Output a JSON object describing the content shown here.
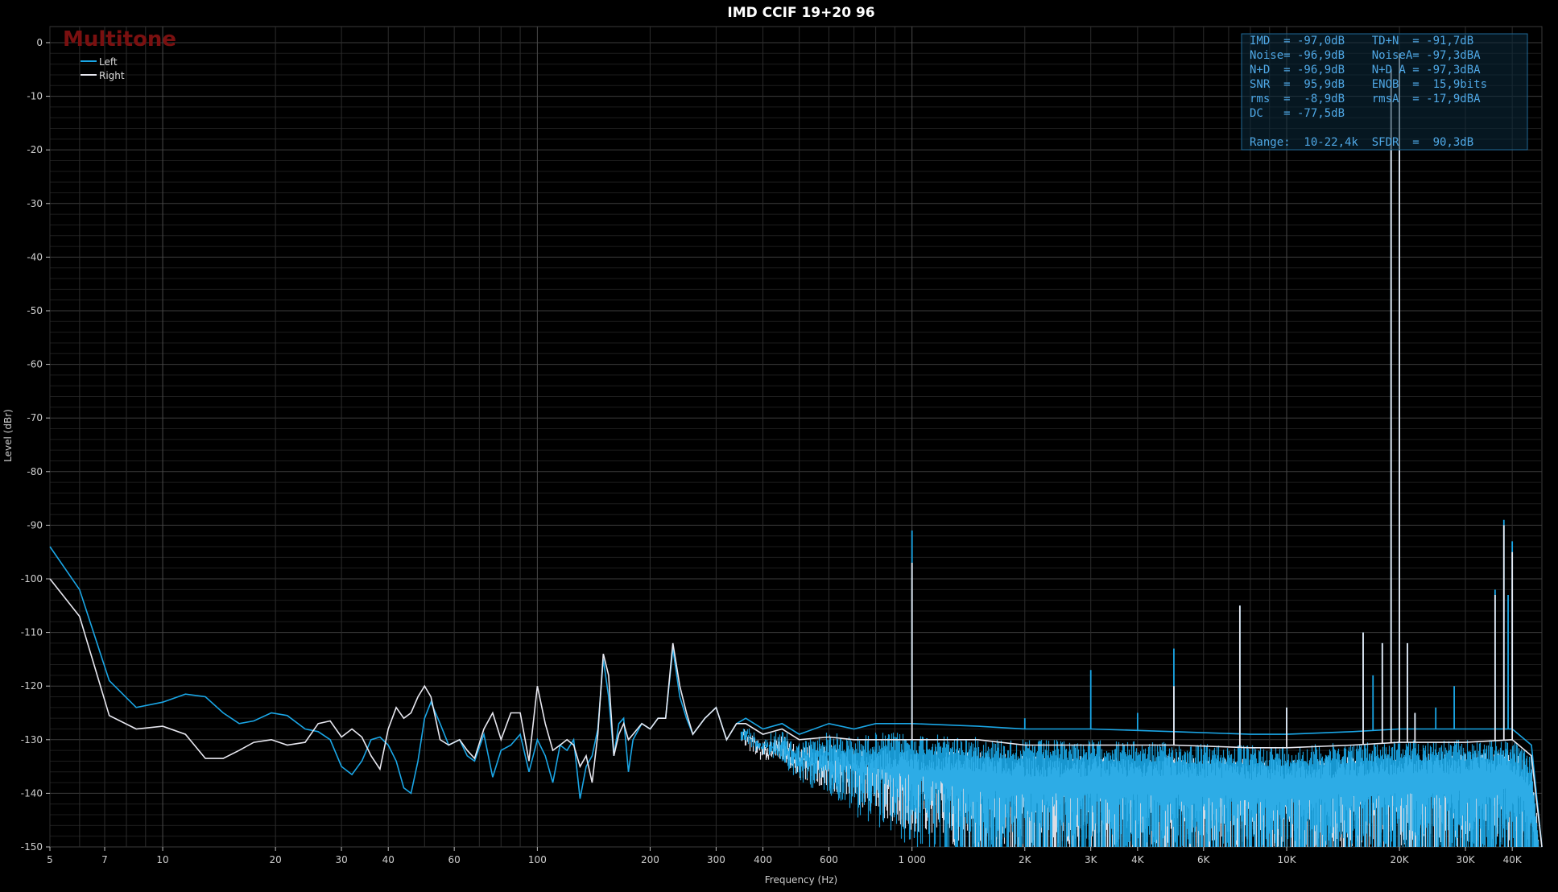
{
  "chart_data": {
    "type": "line",
    "title": "IMD CCIF 19+20 96",
    "brand": "Multitone",
    "xlabel": "Frequency (Hz)",
    "ylabel": "Level (dBr)",
    "x_scale": "log",
    "xlim": [
      5,
      48000
    ],
    "ylim": [
      -150,
      3
    ],
    "grid": true,
    "legend_position": "top-left",
    "x_ticks": [
      {
        "v": 5,
        "label": "5"
      },
      {
        "v": 7,
        "label": "7"
      },
      {
        "v": 10,
        "label": "10"
      },
      {
        "v": 20,
        "label": "20"
      },
      {
        "v": 30,
        "label": "30"
      },
      {
        "v": 40,
        "label": "40"
      },
      {
        "v": 60,
        "label": "60"
      },
      {
        "v": 100,
        "label": "100"
      },
      {
        "v": 200,
        "label": "200"
      },
      {
        "v": 300,
        "label": "300"
      },
      {
        "v": 400,
        "label": "400"
      },
      {
        "v": 600,
        "label": "600"
      },
      {
        "v": 1000,
        "label": "1 000"
      },
      {
        "v": 2000,
        "label": "2K"
      },
      {
        "v": 3000,
        "label": "3K"
      },
      {
        "v": 4000,
        "label": "4K"
      },
      {
        "v": 6000,
        "label": "6K"
      },
      {
        "v": 10000,
        "label": "10K"
      },
      {
        "v": 20000,
        "label": "20K"
      },
      {
        "v": 30000,
        "label": "30K"
      },
      {
        "v": 40000,
        "label": "40K"
      }
    ],
    "y_ticks": [
      0,
      -10,
      -20,
      -30,
      -40,
      -50,
      -60,
      -70,
      -80,
      -90,
      -100,
      -110,
      -120,
      -130,
      -140,
      -150
    ],
    "series": [
      {
        "name": "Left",
        "color": "#1aa6e6",
        "points": [
          [
            5,
            -94
          ],
          [
            6,
            -102
          ],
          [
            7.2,
            -119
          ],
          [
            8.5,
            -124
          ],
          [
            10,
            -123
          ],
          [
            11.5,
            -121.5
          ],
          [
            13,
            -122
          ],
          [
            14.5,
            -125
          ],
          [
            16,
            -127
          ],
          [
            17.5,
            -126.5
          ],
          [
            19.5,
            -125
          ],
          [
            21.5,
            -125.5
          ],
          [
            24,
            -128
          ],
          [
            26,
            -128.5
          ],
          [
            28,
            -130
          ],
          [
            30,
            -135
          ],
          [
            32,
            -136.5
          ],
          [
            34,
            -134
          ],
          [
            36,
            -130
          ],
          [
            38,
            -129.5
          ],
          [
            40,
            -131
          ],
          [
            42,
            -134
          ],
          [
            44,
            -139
          ],
          [
            46,
            -140
          ],
          [
            48,
            -134
          ],
          [
            50,
            -126
          ],
          [
            52,
            -123
          ],
          [
            55,
            -127
          ],
          [
            58,
            -131
          ],
          [
            62,
            -130
          ],
          [
            65,
            -133
          ],
          [
            68,
            -134
          ],
          [
            72,
            -129
          ],
          [
            76,
            -137
          ],
          [
            80,
            -132
          ],
          [
            85,
            -131
          ],
          [
            90,
            -129
          ],
          [
            95,
            -136
          ],
          [
            100,
            -130
          ],
          [
            105,
            -133
          ],
          [
            110,
            -138
          ],
          [
            115,
            -131
          ],
          [
            120,
            -132
          ],
          [
            125,
            -130
          ],
          [
            130,
            -141
          ],
          [
            135,
            -135
          ],
          [
            140,
            -133
          ],
          [
            145,
            -128
          ],
          [
            150,
            -115
          ],
          [
            155,
            -122
          ],
          [
            160,
            -133
          ],
          [
            165,
            -127
          ],
          [
            170,
            -126
          ],
          [
            175,
            -136
          ],
          [
            180,
            -130
          ],
          [
            190,
            -127
          ],
          [
            200,
            -128
          ],
          [
            210,
            -126
          ],
          [
            220,
            -126
          ],
          [
            230,
            -113
          ],
          [
            240,
            -122
          ],
          [
            250,
            -126
          ],
          [
            260,
            -129
          ],
          [
            280,
            -126
          ],
          [
            300,
            -124
          ],
          [
            320,
            -130
          ],
          [
            340,
            -127
          ],
          [
            360,
            -126
          ],
          [
            400,
            -128
          ],
          [
            450,
            -127
          ],
          [
            500,
            -129
          ],
          [
            600,
            -127
          ],
          [
            700,
            -128
          ],
          [
            800,
            -127
          ],
          [
            900,
            -127
          ],
          [
            1000,
            -127
          ],
          [
            1500,
            -127.5
          ],
          [
            2000,
            -128
          ],
          [
            3000,
            -128
          ],
          [
            5000,
            -128.5
          ],
          [
            8000,
            -129
          ],
          [
            10000,
            -129
          ],
          [
            15000,
            -128.5
          ],
          [
            20000,
            -128
          ],
          [
            30000,
            -128
          ],
          [
            40000,
            -128
          ],
          [
            45000,
            -131
          ],
          [
            48000,
            -150
          ]
        ],
        "noise_floor_level": -130,
        "spikes": [
          [
            1000,
            -91
          ],
          [
            2000,
            -126
          ],
          [
            3000,
            -117
          ],
          [
            4000,
            -125
          ],
          [
            5000,
            -113
          ],
          [
            7500,
            -105
          ],
          [
            10000,
            -124
          ],
          [
            16000,
            -110
          ],
          [
            17000,
            -118
          ],
          [
            18000,
            -112
          ],
          [
            19000,
            -5
          ],
          [
            20000,
            -2
          ],
          [
            21000,
            -112
          ],
          [
            22000,
            -125
          ],
          [
            25000,
            -124
          ],
          [
            28000,
            -120
          ],
          [
            36000,
            -102
          ],
          [
            38000,
            -89
          ],
          [
            39000,
            -103
          ],
          [
            40000,
            -93
          ]
        ]
      },
      {
        "name": "Right",
        "color": "#e8e8f0",
        "points": [
          [
            5,
            -100
          ],
          [
            6,
            -107
          ],
          [
            7.2,
            -125.5
          ],
          [
            8.5,
            -128
          ],
          [
            10,
            -127.5
          ],
          [
            11.5,
            -129
          ],
          [
            13,
            -133.5
          ],
          [
            14.5,
            -133.5
          ],
          [
            16,
            -132
          ],
          [
            17.5,
            -130.5
          ],
          [
            19.5,
            -130
          ],
          [
            21.5,
            -131
          ],
          [
            24,
            -130.5
          ],
          [
            26,
            -127
          ],
          [
            28,
            -126.5
          ],
          [
            30,
            -129.5
          ],
          [
            32,
            -128
          ],
          [
            34,
            -129.5
          ],
          [
            36,
            -133
          ],
          [
            38,
            -135.5
          ],
          [
            40,
            -128
          ],
          [
            42,
            -124
          ],
          [
            44,
            -126
          ],
          [
            46,
            -125
          ],
          [
            48,
            -122
          ],
          [
            50,
            -120
          ],
          [
            52,
            -122
          ],
          [
            55,
            -130
          ],
          [
            58,
            -131
          ],
          [
            62,
            -130
          ],
          [
            65,
            -132
          ],
          [
            68,
            -133.5
          ],
          [
            72,
            -128
          ],
          [
            76,
            -125
          ],
          [
            80,
            -130
          ],
          [
            85,
            -125
          ],
          [
            90,
            -125
          ],
          [
            95,
            -134
          ],
          [
            100,
            -120
          ],
          [
            105,
            -127
          ],
          [
            110,
            -132
          ],
          [
            115,
            -131
          ],
          [
            120,
            -130
          ],
          [
            125,
            -131
          ],
          [
            130,
            -135
          ],
          [
            135,
            -133
          ],
          [
            140,
            -138
          ],
          [
            145,
            -129
          ],
          [
            150,
            -114
          ],
          [
            155,
            -118
          ],
          [
            160,
            -133
          ],
          [
            165,
            -129
          ],
          [
            170,
            -127
          ],
          [
            175,
            -130
          ],
          [
            180,
            -129
          ],
          [
            190,
            -127
          ],
          [
            200,
            -128
          ],
          [
            210,
            -126
          ],
          [
            220,
            -126
          ],
          [
            230,
            -112
          ],
          [
            240,
            -120
          ],
          [
            250,
            -125
          ],
          [
            260,
            -129
          ],
          [
            280,
            -126
          ],
          [
            300,
            -124
          ],
          [
            320,
            -130
          ],
          [
            340,
            -127
          ],
          [
            360,
            -127
          ],
          [
            400,
            -129
          ],
          [
            450,
            -128
          ],
          [
            500,
            -130
          ],
          [
            600,
            -129.5
          ],
          [
            700,
            -130
          ],
          [
            800,
            -130
          ],
          [
            900,
            -130
          ],
          [
            1000,
            -130
          ],
          [
            1500,
            -130
          ],
          [
            2000,
            -131
          ],
          [
            3000,
            -131
          ],
          [
            5000,
            -131
          ],
          [
            8000,
            -131.5
          ],
          [
            10000,
            -131.5
          ],
          [
            15000,
            -131
          ],
          [
            20000,
            -130.5
          ],
          [
            30000,
            -130.5
          ],
          [
            40000,
            -130
          ],
          [
            45000,
            -133
          ],
          [
            48000,
            -150
          ]
        ],
        "noise_floor_level": -132,
        "spikes": [
          [
            1000,
            -97
          ],
          [
            5000,
            -120
          ],
          [
            7500,
            -105
          ],
          [
            10000,
            -124
          ],
          [
            16000,
            -110
          ],
          [
            18000,
            -112
          ],
          [
            19000,
            -5
          ],
          [
            20000,
            -2
          ],
          [
            21000,
            -112
          ],
          [
            22000,
            -125
          ],
          [
            36000,
            -103
          ],
          [
            38000,
            -90
          ],
          [
            40000,
            -95
          ]
        ]
      }
    ],
    "stats_lines": [
      "IMD  = -97,0dB    TD+N  = -91,7dB",
      "Noise= -96,9dB    NoiseA= -97,3dBA",
      "N+D  = -96,9dB    N+D A = -97,3dBA",
      "SNR  =  95,9dB    ENOB  =  15,9bits",
      "rms  =  -8,9dB    rmsA  = -17,9dBA",
      "DC   = -77,5dB",
      "",
      "Range:  10-22,4k  SFDR  =  90,3dB"
    ]
  }
}
